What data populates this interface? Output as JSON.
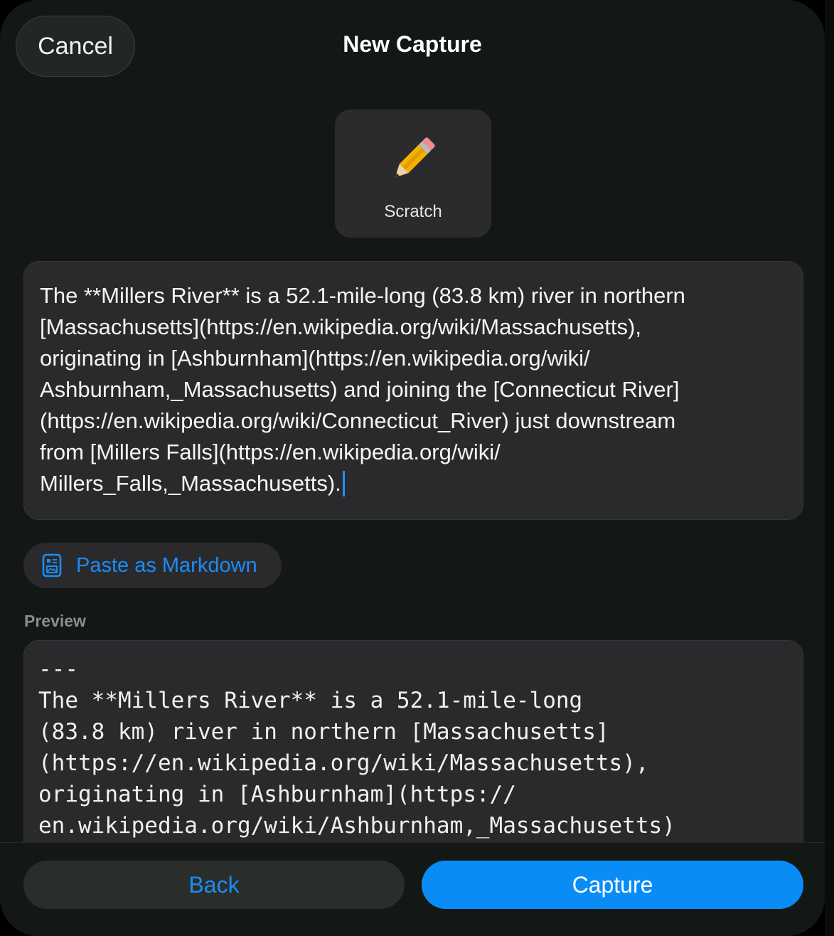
{
  "header": {
    "cancel_label": "Cancel",
    "title": "New Capture"
  },
  "capture_type": {
    "icon": "pencil-icon",
    "label": "Scratch"
  },
  "editor": {
    "text": "The **Millers River** is a 52.1-mile-long (83.8 km) river in northern [Massachusetts](https://en.wikipedia.org/wiki/Massachusetts), originating in [Ashburnham](https://en.wikipedia.org/wiki/Ashburnham,_Massachusetts) and joining the [Connecticut River](https://en.wikipedia.org/wiki/Connecticut_River) just downstream from [Millers Falls](https://en.wikipedia.org/wiki/Millers_Falls,_Massachusetts).",
    "lines": [
      "The **Millers River** is a 52.1-mile-long (83.8 km) river in northern",
      "[Massachusetts](https://en.wikipedia.org/wiki/Massachusetts),",
      "originating in [Ashburnham](https://en.wikipedia.org/wiki/",
      "Ashburnham,_Massachusetts) and joining the [Connecticut River]",
      "(https://en.wikipedia.org/wiki/Connecticut_River) just downstream",
      "from [Millers Falls](https://en.wikipedia.org/wiki/",
      "Millers_Falls,_Massachusetts)."
    ]
  },
  "paste_button": {
    "icon": "paste-markdown-icon",
    "label": "Paste as Markdown"
  },
  "preview": {
    "label": "Preview",
    "lines": [
      "---",
      "The **Millers River** is a 52.1-mile-long",
      "(83.8 km) river in northern [Massachusetts]",
      "(https://en.wikipedia.org/wiki/Massachusetts),",
      "originating in [Ashburnham](https://",
      "en.wikipedia.org/wiki/Ashburnham,_Massachusetts)"
    ]
  },
  "footer": {
    "back_label": "Back",
    "capture_label": "Capture"
  },
  "colors": {
    "accent": "#0a8cf7",
    "link_text": "#1c8cf5",
    "background": "#141815"
  }
}
